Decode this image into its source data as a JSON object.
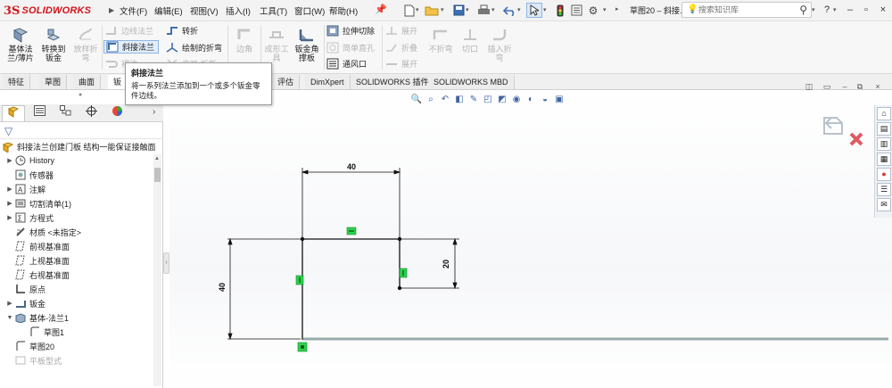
{
  "app": {
    "logo_ds": "3S",
    "logo_name": "SOLIDWORKS"
  },
  "menu": [
    "文件(F)",
    "编辑(E)",
    "视图(V)",
    "插入(I)",
    "工具(T)",
    "窗口(W)",
    "帮助(H)"
  ],
  "document_title": "草图20 – 斜接…",
  "search": {
    "placeholder": "搜索知识库",
    "lead_icon": "bulb-icon",
    "icon": "magnifier-icon"
  },
  "title_controls": [
    "?",
    "–",
    "▫",
    "×"
  ],
  "ribbon": {
    "big_buttons": [
      {
        "label": "基体法\n兰/薄片",
        "icon": "base-flange-icon",
        "enabled": true
      },
      {
        "label": "转换到\n钣金",
        "icon": "convert-to-sheetmetal-icon",
        "enabled": true
      },
      {
        "label": "放样折\n弯",
        "icon": "lofted-bend-icon",
        "enabled": false
      }
    ],
    "col1": [
      {
        "label": "边线法兰",
        "icon": "edge-flange-icon",
        "enabled": false
      },
      {
        "label": "斜接法兰",
        "icon": "miter-flange-icon",
        "enabled": true,
        "highlighted": true
      },
      {
        "label": "褶边",
        "icon": "hem-icon",
        "enabled": false
      }
    ],
    "col2": [
      {
        "label": "转折",
        "icon": "jog-icon",
        "enabled": true
      },
      {
        "label": "绘制的折弯",
        "icon": "sketched-bend-icon",
        "enabled": true
      },
      {
        "label": "交叉-折断",
        "icon": "cross-break-icon",
        "enabled": false
      }
    ],
    "mid_buttons": [
      {
        "label": "边角",
        "icon": "corners-icon",
        "enabled": false
      },
      {
        "label": "成形工\n具",
        "icon": "forming-tool-icon",
        "enabled": false
      },
      {
        "label": "钣金角\n撑板",
        "icon": "sheetmetal-gusset-icon",
        "enabled": true
      }
    ],
    "col3": [
      {
        "label": "拉伸切除",
        "icon": "extruded-cut-icon",
        "enabled": true
      },
      {
        "label": "简单直孔",
        "icon": "simple-hole-icon",
        "enabled": false
      },
      {
        "label": "通风口",
        "icon": "vent-icon",
        "enabled": true
      }
    ],
    "col4": [
      {
        "label": "展开",
        "icon": "unfold-icon",
        "enabled": false
      },
      {
        "label": "折叠",
        "icon": "fold-icon",
        "enabled": false
      },
      {
        "label": "展开",
        "icon": "flatten-icon",
        "enabled": false
      }
    ],
    "end_buttons": [
      {
        "label": "不折弯",
        "icon": "no-bends-icon",
        "enabled": false
      },
      {
        "label": "切口",
        "icon": "rip-icon",
        "enabled": false
      },
      {
        "label": "插入折\n弯",
        "icon": "insert-bends-icon",
        "enabled": false
      }
    ]
  },
  "tabs": [
    "特征",
    "草图",
    "曲面",
    "钣",
    "评估",
    "DimXpert",
    "SOLIDWORKS 插件",
    "SOLIDWORKS MBD"
  ],
  "tooltip": {
    "title": "斜接法兰",
    "body": "将一系列法兰添加到一个或多个钣金零件边线。"
  },
  "feature_tree": {
    "root": "斜接法兰创建门板 结构一能保证接触面",
    "items": [
      {
        "label": "History",
        "icon": "history-icon",
        "expander": true
      },
      {
        "label": "传感器",
        "icon": "sensor-icon",
        "expander": false
      },
      {
        "label": "注解",
        "icon": "annotations-icon",
        "expander": true
      },
      {
        "label": "切割清单(1)",
        "icon": "cut-list-icon",
        "expander": true
      },
      {
        "label": "方程式",
        "icon": "equations-icon",
        "expander": true
      },
      {
        "label": "材质 <未指定>",
        "icon": "material-icon",
        "expander": false
      },
      {
        "label": "前视基准面",
        "icon": "plane-icon",
        "expander": false
      },
      {
        "label": "上视基准面",
        "icon": "plane-icon",
        "expander": false
      },
      {
        "label": "右视基准面",
        "icon": "plane-icon",
        "expander": false
      },
      {
        "label": "原点",
        "icon": "origin-icon",
        "expander": false
      },
      {
        "label": "钣金",
        "icon": "sheet-metal-icon",
        "expander": true
      },
      {
        "label": "基体-法兰1",
        "icon": "base-flange-feature-icon",
        "expander": true,
        "expanded": true
      },
      {
        "label": "草图1",
        "icon": "sketch-icon",
        "expander": false,
        "indent": true
      },
      {
        "label": "草图20",
        "icon": "sketch-icon",
        "expander": false
      },
      {
        "label": "平板型式",
        "icon": "flat-pattern-icon",
        "expander": false,
        "faded": true
      }
    ]
  },
  "sketch": {
    "dimensions": [
      "40",
      "20",
      "40"
    ]
  },
  "colors": {
    "accent": "#d2141b",
    "relation_green": "#2bd24b",
    "confirm_gray": "#b8c2cc",
    "cancel_red": "#e05a62"
  }
}
